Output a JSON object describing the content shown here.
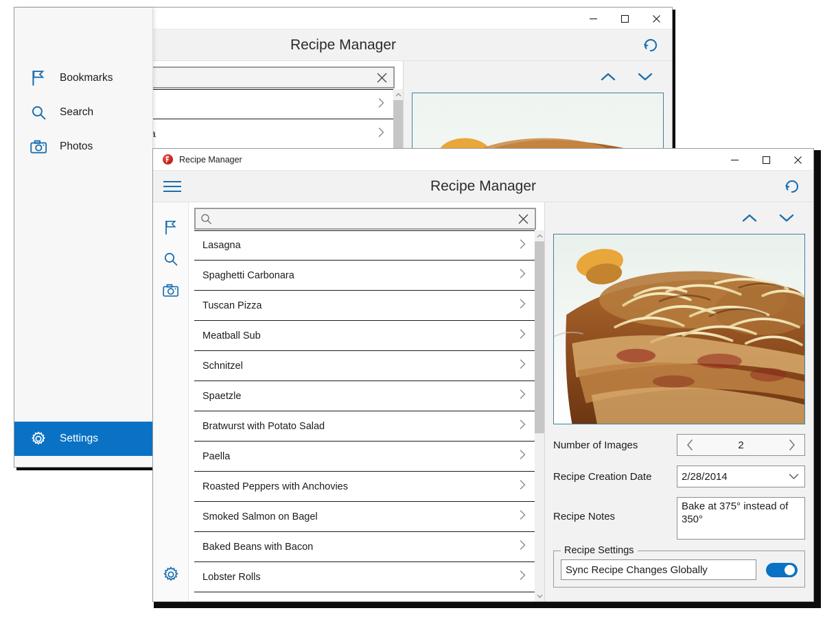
{
  "app": {
    "window_title": "Recipe Manager",
    "header_title": "Recipe Manager",
    "logo_icon": "recipe-manager-logo",
    "hamburger_icon": "hamburger-menu-icon",
    "refresh_icon": "refresh-icon",
    "minimize_label": "—",
    "maximize_label": "□",
    "close_label": "✕"
  },
  "flyout": {
    "items": [
      {
        "label": "Bookmarks",
        "icon": "flag-icon",
        "selected": false
      },
      {
        "label": "Search",
        "icon": "search-icon",
        "selected": false
      },
      {
        "label": "Photos",
        "icon": "camera-icon",
        "selected": false
      }
    ],
    "bottom": {
      "label": "Settings",
      "icon": "gear-icon",
      "selected": true
    },
    "selected_color": "#0a72c4"
  },
  "rail": {
    "top_icons": [
      "flag-icon",
      "search-icon",
      "camera-icon"
    ],
    "bottom_icon": "gear-icon",
    "icon_color": "#1b6fb0"
  },
  "search": {
    "value": "",
    "placeholder": "",
    "search_icon": "search-icon",
    "clear_icon": "clear-x-icon"
  },
  "recipes": [
    {
      "name": "Lasagna"
    },
    {
      "name": "Spaghetti Carbonara"
    },
    {
      "name": "Tuscan Pizza"
    },
    {
      "name": "Meatball Sub"
    },
    {
      "name": "Schnitzel"
    },
    {
      "name": "Spaetzle"
    },
    {
      "name": "Bratwurst with Potato Salad"
    },
    {
      "name": "Paella"
    },
    {
      "name": "Roasted Peppers with Anchovies"
    },
    {
      "name": "Smoked Salmon on Bagel"
    },
    {
      "name": "Baked Beans with Bacon"
    },
    {
      "name": "Lobster Rolls"
    }
  ],
  "scrollbar": {
    "up_arrow_icon": "scroll-up-icon",
    "down_arrow_icon": "scroll-down-icon",
    "thumb_top_percent": 0,
    "thumb_height_percent": 55
  },
  "detail": {
    "nav_up_icon": "chevron-up-icon",
    "nav_down_icon": "chevron-down-icon",
    "photo_alt": "lasagna-photo",
    "fields": {
      "number_of_images": {
        "label": "Number of Images",
        "value": "2",
        "prev_icon": "chevron-left-icon",
        "next_icon": "chevron-right-icon"
      },
      "creation_date": {
        "label": "Recipe Creation Date",
        "value": "2/28/2014",
        "dropdown_icon": "chevron-down-icon"
      },
      "notes": {
        "label": "Recipe Notes",
        "value": "Bake at 375° instead of 350°"
      }
    },
    "settings_group": {
      "legend": "Recipe Settings",
      "setting_name": "Sync Recipe Changes Globally",
      "toggle_on": true,
      "toggle_color": "#0a72c4"
    }
  },
  "colors": {
    "accent": "#0a72c4",
    "icon_blue": "#1b6fb0",
    "header_bg": "#f2f2f2",
    "detail_bg": "#f2f2f2"
  }
}
